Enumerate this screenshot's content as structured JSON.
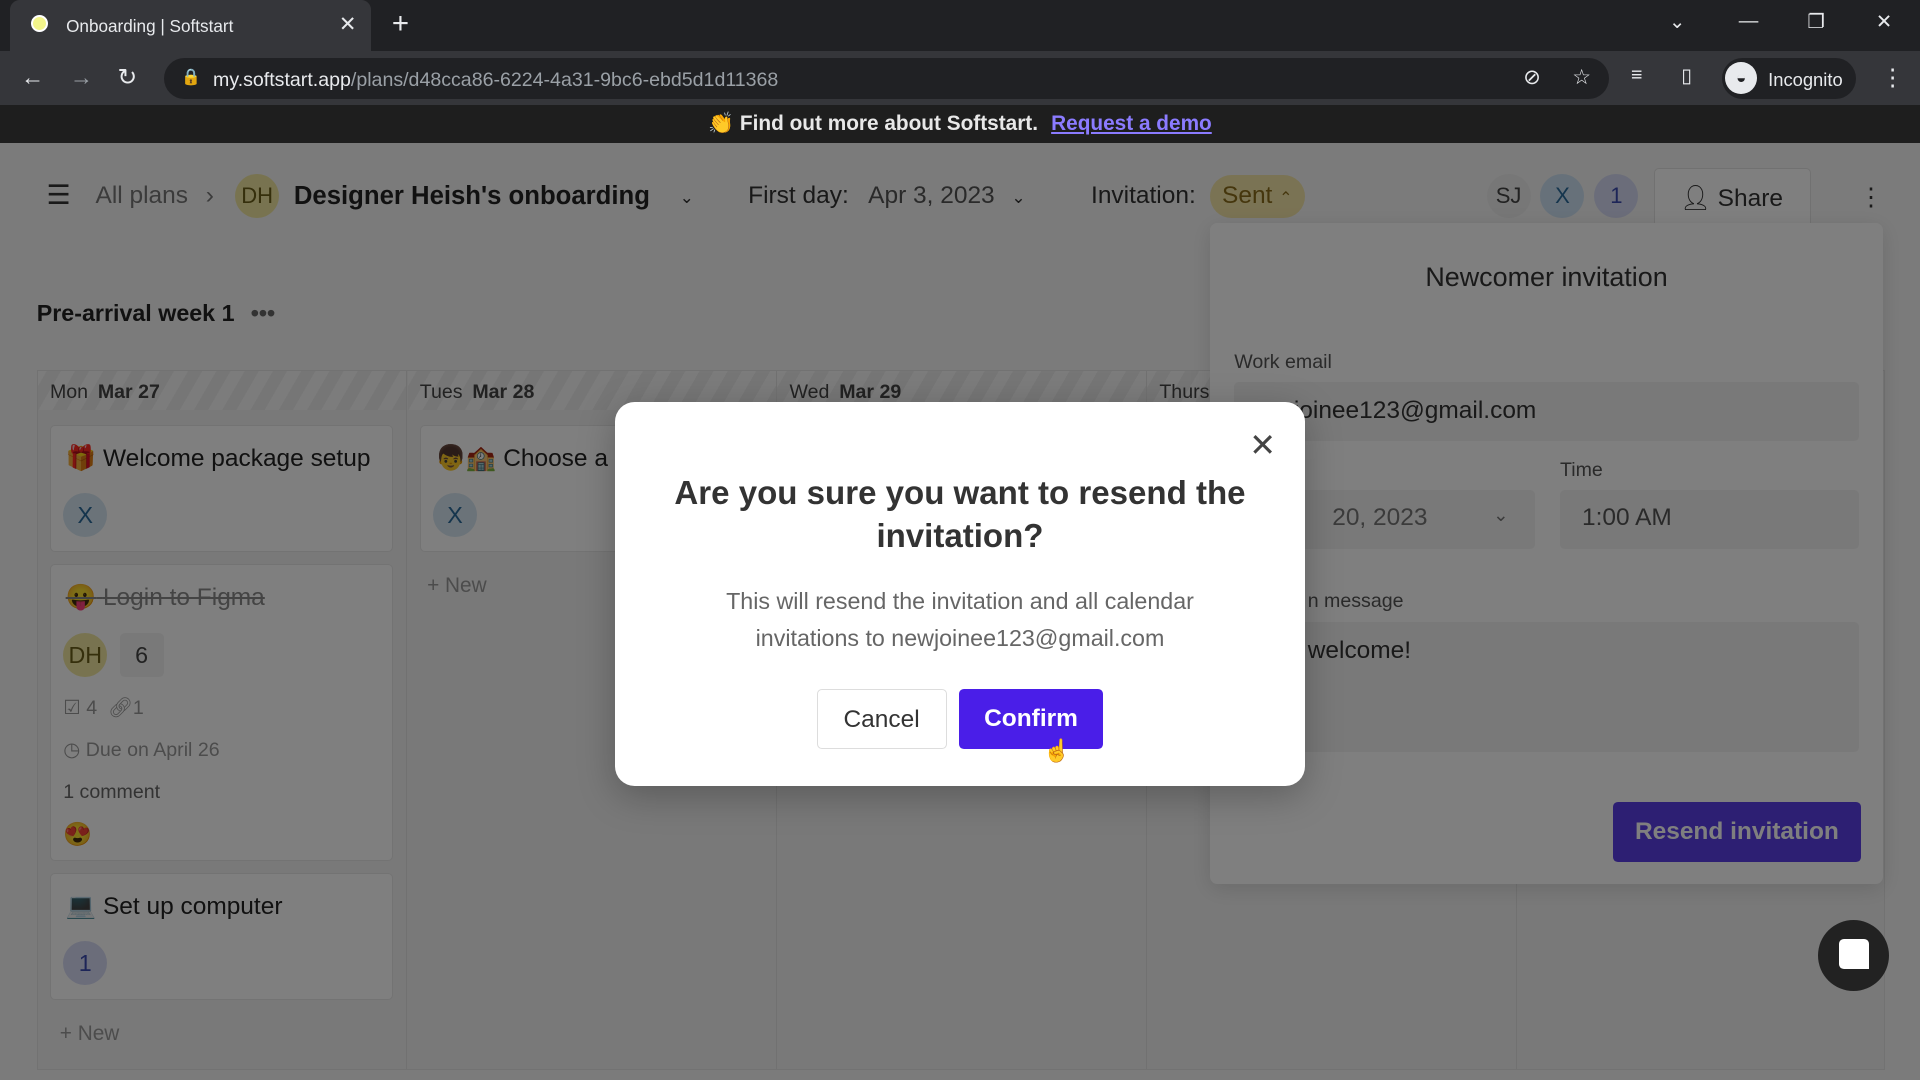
{
  "browser": {
    "tab_title": "Onboarding | Softstart",
    "url_host": "my.softstart.app",
    "url_path": "/plans/d48cca86-6224-4a31-9bc6-ebd5d1d11368",
    "profile_label": "Incognito"
  },
  "banner": {
    "text": "Find out more about Softstart.",
    "link": "Request a demo",
    "emoji": "👏"
  },
  "header": {
    "breadcrumb_root": "All plans",
    "plan_avatar": "DH",
    "plan_title": "Designer Heish's onboarding",
    "first_day_label": "First day:",
    "first_day_value": "Apr 3, 2023",
    "invitation_label": "Invitation:",
    "invitation_status": "Sent",
    "members": [
      "SJ",
      "X",
      "1"
    ],
    "share_label": "Share"
  },
  "section": {
    "title": "Pre-arrival week 1"
  },
  "columns": [
    {
      "day": "Mon",
      "date": "Mar 27"
    },
    {
      "day": "Tues",
      "date": "Mar 28"
    },
    {
      "day": "Wed",
      "date": "Mar 29"
    },
    {
      "day": "Thurs",
      "date": ""
    }
  ],
  "cards": {
    "welcome": {
      "emoji": "🎁",
      "title": "Welcome package setup",
      "assignee": "X"
    },
    "figma": {
      "emoji": "😛",
      "title": "Login to Figma",
      "assignee": "DH",
      "count": "6",
      "checklist": "4",
      "links": "1",
      "due": "Due on April 26",
      "comments": "1 comment",
      "reaction": "😍"
    },
    "computer": {
      "emoji": "💻",
      "title": "Set up computer",
      "assignee": "1"
    },
    "choose": {
      "emoji": "👦🏫",
      "title": "Choose a",
      "assignee": "X"
    },
    "new_label": "New"
  },
  "invitation_panel": {
    "title": "Newcomer invitation",
    "email_label": "Work email",
    "email_value": "newjoinee123@gmail.com",
    "date_value": "20, 2023",
    "time_label": "Time",
    "time_value": "1:00 AM",
    "message_label": "n message",
    "message_value": "welcome!",
    "resend_label": "Resend invitation"
  },
  "modal": {
    "title": "Are you sure you want to resend the invitation?",
    "body": "This will resend the invitation and all calendar invitations to newjoinee123@gmail.com",
    "cancel": "Cancel",
    "confirm": "Confirm"
  },
  "colors": {
    "accent": "#4a1ee8",
    "status_sent": "#f5e6a8"
  }
}
